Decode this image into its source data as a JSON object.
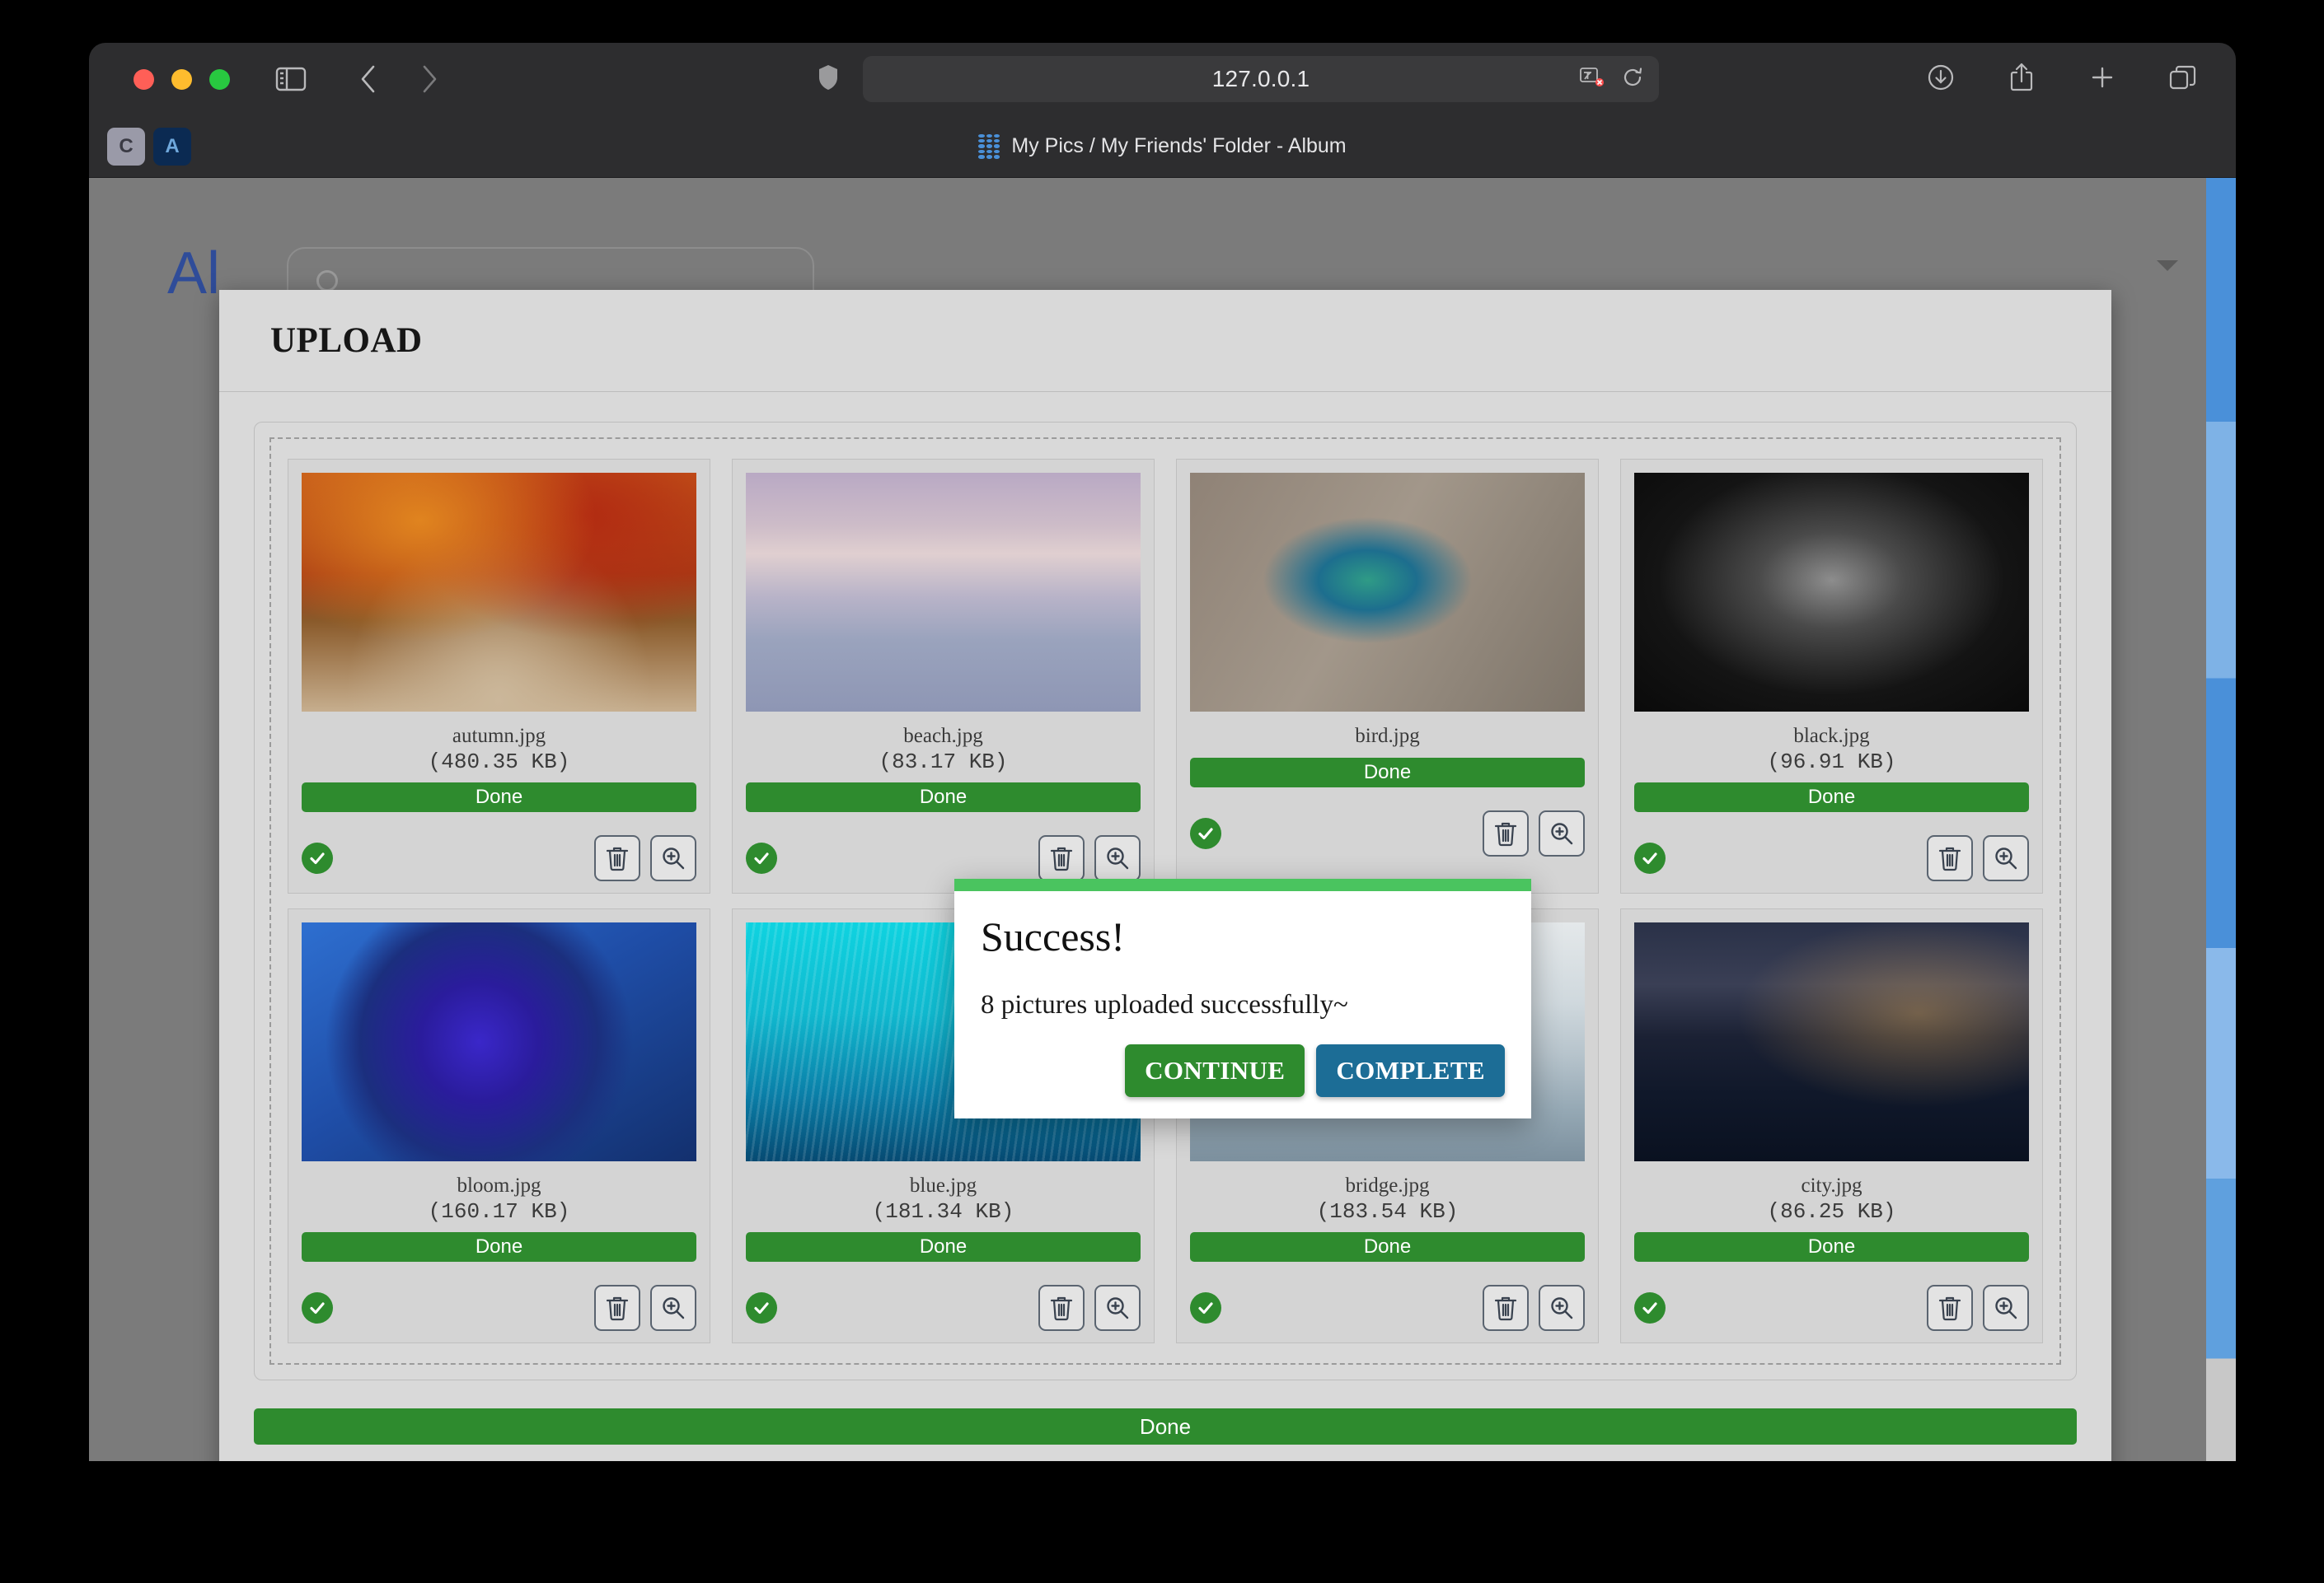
{
  "browser": {
    "url": "127.0.0.1",
    "tab_title": "My Pics / My Friends' Folder - Album",
    "favicon_left_label": "C",
    "favicon_right_label": "A",
    "toolbar_icons": [
      "sidebar-icon",
      "back-icon",
      "forward-icon",
      "shield-icon",
      "translate-icon",
      "reload-icon",
      "downloads-icon",
      "share-icon",
      "new-tab-icon",
      "tab-overview-icon"
    ]
  },
  "background_app": {
    "logo_text": "Al",
    "search_placeholder": ""
  },
  "fabs": [
    {
      "name": "upload-image-fab",
      "icon": "image-upload-icon",
      "color": "#1f6389"
    },
    {
      "name": "tag-fab",
      "icon": "tag-icon",
      "color": "#a36209"
    },
    {
      "name": "list-fab",
      "icon": "list-icon",
      "color": "#225e80"
    }
  ],
  "modal": {
    "title": "UPLOAD",
    "overall_status": "Done",
    "footer_button_label": ""
  },
  "files": [
    {
      "name": "autumn.jpg",
      "size": "(480.35 KB)",
      "status": "Done",
      "thumb": "autumn-forest"
    },
    {
      "name": "beach.jpg",
      "size": "(83.17 KB)",
      "status": "Done",
      "thumb": "beach-pier"
    },
    {
      "name": "bird.jpg",
      "size": "",
      "status": "Done",
      "thumb": "hummingbird"
    },
    {
      "name": "black.jpg",
      "size": "(96.91 KB)",
      "status": "Done",
      "thumb": "hooded-portrait"
    },
    {
      "name": "bloom.jpg",
      "size": "(160.17 KB)",
      "status": "Done",
      "thumb": "blue-rose"
    },
    {
      "name": "blue.jpg",
      "size": "(181.34 KB)",
      "status": "Done",
      "thumb": "blue-grass"
    },
    {
      "name": "bridge.jpg",
      "size": "(183.54 KB)",
      "status": "Done",
      "thumb": "golden-gate"
    },
    {
      "name": "city.jpg",
      "size": "(86.25 KB)",
      "status": "Done",
      "thumb": "city-skyline"
    }
  ],
  "dialog": {
    "title": "Success!",
    "message": "8 pictures uploaded successfully~",
    "continue_label": "CONTINUE",
    "complete_label": "COMPLETE",
    "accent_color": "#4ac45f",
    "continue_color": "#2e8b2e",
    "complete_color": "#1c6d96"
  }
}
